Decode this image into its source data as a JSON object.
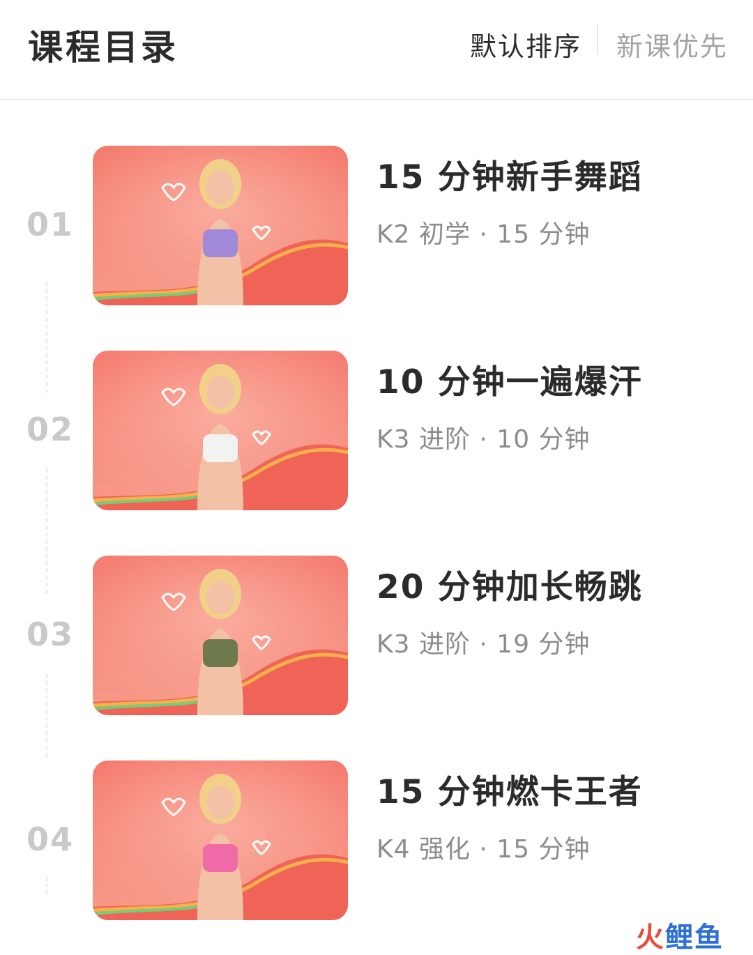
{
  "header": {
    "title": "课程目录",
    "sort_default": "默认排序",
    "sort_new": "新课优先"
  },
  "courses": [
    {
      "index": "01",
      "title": "15 分钟新手舞蹈",
      "meta": "K2 初学 · 15 分钟",
      "thumb_top_color": "#f47a6d",
      "shirt_color": "#a08ad8"
    },
    {
      "index": "02",
      "title": "10 分钟一遍爆汗",
      "meta": "K3 进阶 · 10 分钟",
      "thumb_top_color": "#f57c70",
      "shirt_color": "#f2f2f2"
    },
    {
      "index": "03",
      "title": "20 分钟加长畅跳",
      "meta": "K3 进阶 · 19 分钟",
      "thumb_top_color": "#f47b6f",
      "shirt_color": "#6f7a4c"
    },
    {
      "index": "04",
      "title": "15 分钟燃卡王者",
      "meta": "K4 强化 · 15 分钟",
      "thumb_top_color": "#f57a6e",
      "shirt_color": "#f06aa8"
    }
  ],
  "watermark": {
    "c1": "火",
    "c2": "鲤",
    "c3": "鱼"
  },
  "colors": {
    "index_gray": "#c9c9c9",
    "meta_gray": "#8c8c8c",
    "thumb_bg": "#f4796b",
    "wave_orange": "#f7a24a",
    "wave_red": "#ee5a4f"
  }
}
